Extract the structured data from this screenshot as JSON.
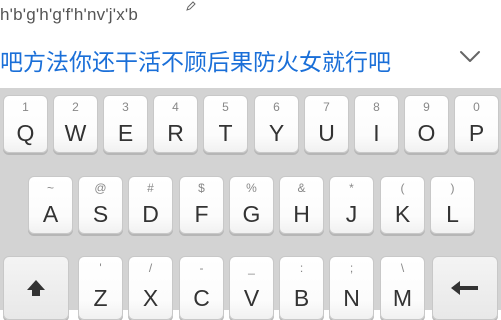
{
  "pinyin": {
    "text": "h'b'g'h'g'f'h'nv'j'x'b"
  },
  "candidate": {
    "text": "吧方法你还干活不顾后果防火女就行吧"
  },
  "keyboard": {
    "row1": [
      {
        "sub": "1",
        "main": "Q"
      },
      {
        "sub": "2",
        "main": "W"
      },
      {
        "sub": "3",
        "main": "E"
      },
      {
        "sub": "4",
        "main": "R"
      },
      {
        "sub": "5",
        "main": "T"
      },
      {
        "sub": "6",
        "main": "Y"
      },
      {
        "sub": "7",
        "main": "U"
      },
      {
        "sub": "8",
        "main": "I"
      },
      {
        "sub": "9",
        "main": "O"
      },
      {
        "sub": "0",
        "main": "P"
      }
    ],
    "row2": [
      {
        "sub": "~",
        "main": "A"
      },
      {
        "sub": "@",
        "main": "S"
      },
      {
        "sub": "#",
        "main": "D"
      },
      {
        "sub": "$",
        "main": "F"
      },
      {
        "sub": "%",
        "main": "G"
      },
      {
        "sub": "&",
        "main": "H"
      },
      {
        "sub": "*",
        "main": "J"
      },
      {
        "sub": "(",
        "main": "K"
      },
      {
        "sub": ")",
        "main": "L"
      }
    ],
    "row3": [
      {
        "sub": "'",
        "main": "Z"
      },
      {
        "sub": "/",
        "main": "X"
      },
      {
        "sub": "-",
        "main": "C"
      },
      {
        "sub": "_",
        "main": "V"
      },
      {
        "sub": ":",
        "main": "B"
      },
      {
        "sub": ";",
        "main": "N"
      },
      {
        "sub": "\\",
        "main": "M"
      }
    ],
    "icons": {
      "shift": "shift-arrow-up-icon",
      "backspace": "backspace-arrow-left-icon",
      "collapse": "chevron-down-icon",
      "edit": "pencil-icon"
    }
  }
}
